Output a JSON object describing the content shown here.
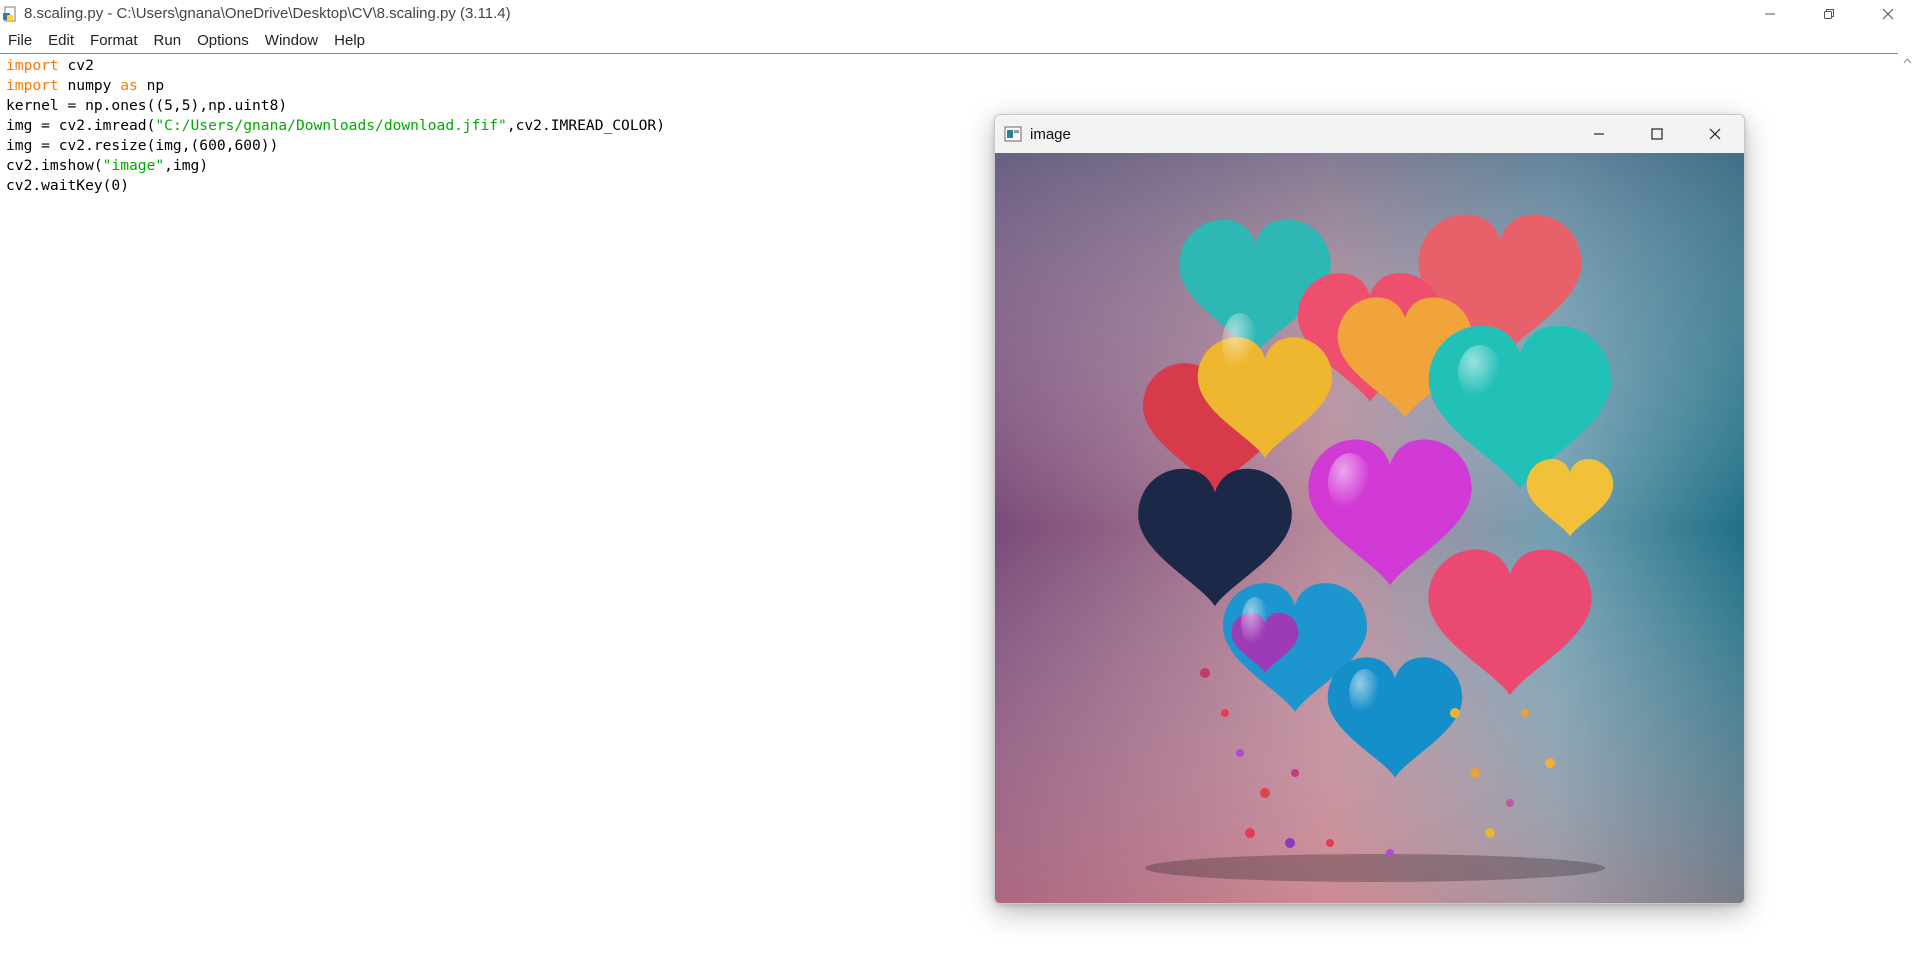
{
  "window": {
    "title": "8.scaling.py - C:\\Users\\gnana\\OneDrive\\Desktop\\CV\\8.scaling.py (3.11.4)"
  },
  "menu": [
    "File",
    "Edit",
    "Format",
    "Run",
    "Options",
    "Window",
    "Help"
  ],
  "code": {
    "line1": {
      "kw": "import",
      "rest": " cv2"
    },
    "line2": {
      "kw1": "import",
      "mid": " numpy ",
      "kw2": "as",
      "rest": " np"
    },
    "line3": "kernel = np.ones((5,5),np.uint8)",
    "line4": {
      "pre": "img = cv2.imread(",
      "str": "\"C:/Users/gnana/Downloads/download.jfif\"",
      "post": ",cv2.IMREAD_COLOR)"
    },
    "line5": "img = cv2.resize(img,(600,600))",
    "line6": {
      "pre": "cv2.imshow(",
      "str": "\"image\"",
      "post": ",img)"
    },
    "line7": "cv2.waitKey(0)"
  },
  "image_window": {
    "title": "image"
  },
  "icons": {
    "app": "python-file-icon",
    "minimize": "minimize-icon",
    "restore": "restore-icon",
    "maximize": "maximize-icon",
    "close": "close-icon",
    "cv_app": "opencv-window-icon"
  },
  "colors": {
    "keyword": "#ff7700",
    "string": "#00aa00"
  }
}
